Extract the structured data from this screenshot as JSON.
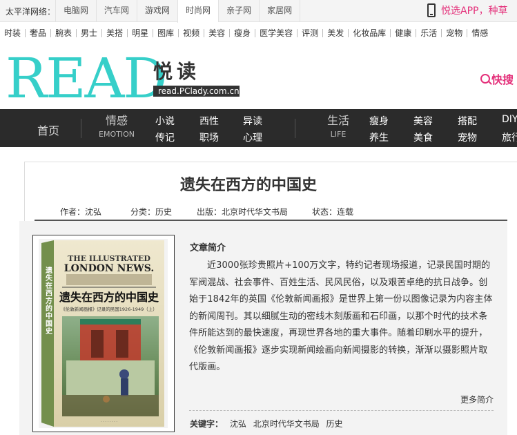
{
  "topbar": {
    "brand": "太平洋网络：",
    "sites": [
      "电脑网",
      "汽车网",
      "游戏网",
      "时尚网",
      "亲子网",
      "家居网"
    ],
    "active_site": "时尚网",
    "app_text": "悦选APP，种草"
  },
  "channels": [
    "时装",
    "奢品",
    "腕表",
    "男士",
    "美搭",
    "明星",
    "图库",
    "视频",
    "美容",
    "瘦身",
    "医学美容",
    "评测",
    "美发",
    "化妆品库",
    "健康",
    "乐活",
    "宠物",
    "情感"
  ],
  "logo": {
    "en": "READ",
    "cn": "悦读",
    "url": "read.PClady.com.cn"
  },
  "quick_text": "快搜",
  "nav": {
    "home": "首页",
    "emotion": {
      "title": "情感",
      "subtitle": "EMOTION",
      "links": [
        "小说",
        "西性",
        "异读",
        "传记",
        "职场",
        "心理"
      ]
    },
    "life": {
      "title": "生活",
      "subtitle": "LIFE",
      "links": [
        "瘦身",
        "美容",
        "搭配",
        "DIY",
        "养生",
        "美食",
        "宠物",
        "旅行"
      ]
    }
  },
  "book": {
    "title": "遗失在西方的中国史",
    "meta": {
      "author": "作者：沈弘",
      "category": "分类：历史",
      "publisher": "出版：北京时代华文书局",
      "status": "状态：连载"
    },
    "cover": {
      "line1": "THE ILLUSTRATED",
      "line2": "LONDON NEWS.",
      "cn_title": "遗失在西方的中国史",
      "cn_sub": "《伦敦新闻画报》记录的民国1926-1949（上）",
      "spine": "遗失在西方的中国史"
    },
    "intro_heading": "文章简介",
    "intro": "近3000张珍贵照片+100万文字，特约记者现场报道，记录民国时期的军阀混战、社会事件、百姓生活、民风民俗，以及艰苦卓绝的抗日战争。创始于1842年的英国《伦敦新闻画报》是世界上第一份以图像记录为内容主体的新闻周刊。其以细腻生动的密线木刻版画和石印画，以那个时代的技术条件所能达到的最快速度，再现世界各地的重大事件。随着印刷水平的提升，《伦敦新闻画报》逐步实现新闻绘画向新闻摄影的转换，渐渐以摄影照片取代版画。",
    "more": "更多简介",
    "keywords_label": "关键字：",
    "keywords": [
      "沈弘",
      "北京时代华文书局",
      "历史"
    ]
  },
  "colors": {
    "brand_teal": "#36cfc9",
    "accent_pink": "#e4307a",
    "nav_bg": "#2b2b2b"
  }
}
